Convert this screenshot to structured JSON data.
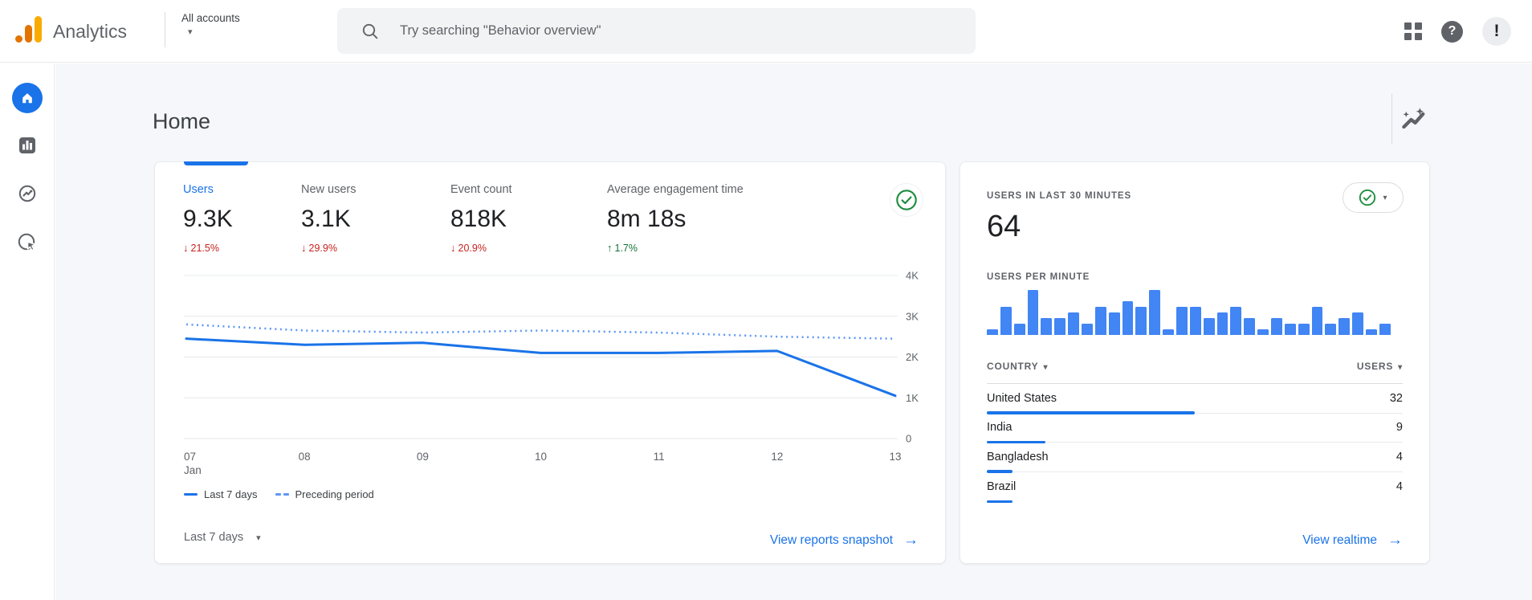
{
  "topbar": {
    "brand": "Analytics",
    "account_selector": "All accounts",
    "search": {
      "placeholder": "Try searching \"Behavior overview\""
    },
    "help_glyph": "?",
    "avatar_glyph": "!"
  },
  "icons": {
    "caret_down": "▾",
    "arrow_right": "→",
    "arrow_up": "↑",
    "arrow_down": "↓"
  },
  "colors": {
    "accent": "#1a73e8",
    "bar_blue": "#4285f4",
    "negative": "#c5221f",
    "positive": "#137333",
    "check_green": "#1e8e3e"
  },
  "page": {
    "title": "Home"
  },
  "main_card": {
    "metrics": [
      {
        "label": "Users",
        "value": "9.3K",
        "delta": "21.5%",
        "direction": "down",
        "active": true
      },
      {
        "label": "New users",
        "value": "3.1K",
        "delta": "29.9%",
        "direction": "down",
        "active": false
      },
      {
        "label": "Event count",
        "value": "818K",
        "delta": "20.9%",
        "direction": "down",
        "active": false
      },
      {
        "label": "Average engagement time",
        "value": "8m 18s",
        "delta": "1.7%",
        "direction": "up",
        "active": false
      }
    ],
    "legend": [
      {
        "label": "Last 7 days",
        "style": "solid"
      },
      {
        "label": "Preceding period",
        "style": "dashed"
      }
    ],
    "date_range": "Last 7 days",
    "footer_link": "View reports snapshot"
  },
  "chart_data": [
    {
      "type": "line",
      "title": "Users over time",
      "x": [
        "07",
        "08",
        "09",
        "10",
        "11",
        "12",
        "13"
      ],
      "x_sub_first": "Jan",
      "series": [
        {
          "name": "Last 7 days",
          "style": "solid",
          "values": [
            2450,
            2300,
            2350,
            2100,
            2100,
            2150,
            1050
          ]
        },
        {
          "name": "Preceding period",
          "style": "dashed",
          "values": [
            2800,
            2650,
            2600,
            2650,
            2600,
            2500,
            2450
          ]
        }
      ],
      "ylim": [
        0,
        4000
      ],
      "yticks": [
        "4K",
        "3K",
        "2K",
        "1K",
        "0"
      ],
      "grid": true,
      "legend_position": "bottom-left"
    },
    {
      "type": "bar",
      "title": "USERS PER MINUTE",
      "values": [
        1,
        5,
        2,
        8,
        3,
        3,
        4,
        2,
        5,
        4,
        6,
        5,
        8,
        1,
        5,
        5,
        3,
        4,
        5,
        3,
        1,
        3,
        2,
        2,
        5,
        2,
        3,
        4,
        1,
        2
      ],
      "ylim": [
        0,
        8
      ]
    }
  ],
  "realtime_card": {
    "title": "USERS IN LAST 30 MINUTES",
    "users_30min": "64",
    "per_minute_title": "USERS PER MINUTE",
    "table": {
      "columns": [
        "COUNTRY",
        "USERS"
      ],
      "rows": [
        {
          "country": "United States",
          "users": 32
        },
        {
          "country": "India",
          "users": 9
        },
        {
          "country": "Bangladesh",
          "users": 4
        },
        {
          "country": "Brazil",
          "users": 4
        }
      ]
    },
    "footer_link": "View realtime"
  }
}
